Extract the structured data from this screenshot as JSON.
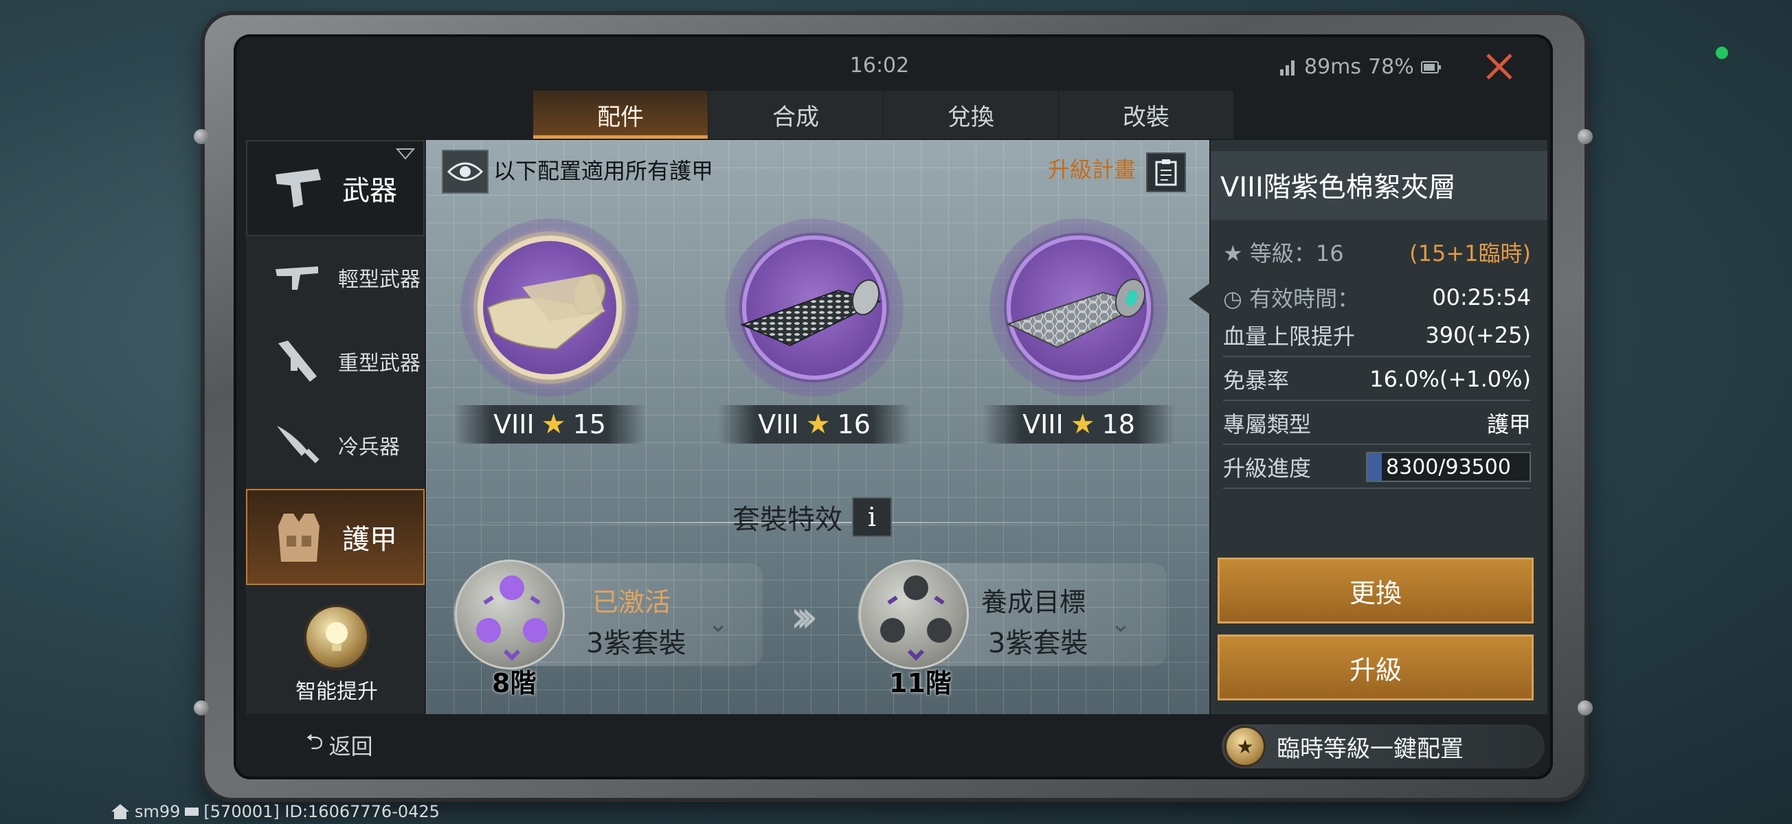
{
  "status": {
    "time": "16:02",
    "ping": "89ms",
    "battery": "78%"
  },
  "tabs": [
    {
      "label": "配件",
      "active": true
    },
    {
      "label": "合成",
      "active": false
    },
    {
      "label": "兌換",
      "active": false
    },
    {
      "label": "改裝",
      "active": false
    }
  ],
  "sidebar": {
    "weapons": "武器",
    "light": "輕型武器",
    "heavy": "重型武器",
    "melee": "冷兵器",
    "armor": "護甲",
    "smart": "智能提升"
  },
  "main": {
    "info_text": "以下配置適用所有護甲",
    "plan_label": "升級計畫",
    "items": [
      {
        "tier": "VIII",
        "stars": "15",
        "selected": true
      },
      {
        "tier": "VIII",
        "stars": "16",
        "selected": false
      },
      {
        "tier": "VIII",
        "stars": "18",
        "selected": false
      }
    ],
    "set_title": "套裝特效",
    "set_info_icon": "i",
    "set_current": {
      "state": "已激活",
      "name": "3紫套裝",
      "level": "8階"
    },
    "set_target": {
      "state": "養成目標",
      "name": "3紫套裝",
      "level": "11階"
    }
  },
  "detail": {
    "title": "VIII階紫色棉絮夾層",
    "level_key": "等級：16",
    "level_val": "(15+1臨時)",
    "time_key": "有效時間：",
    "time_val": "00:25:54",
    "hp_key": "血量上限提升",
    "hp_val": "390(+25)",
    "crit_key": "免暴率",
    "crit_val": "16.0%(+1.0%)",
    "type_key": "專屬類型",
    "type_val": "護甲",
    "progress_key": "升級進度",
    "progress_text": "8300/93500",
    "progress_fraction": 0.089,
    "replace_btn": "更換",
    "upgrade_btn": "升級"
  },
  "bottom": {
    "back": "返回",
    "quick": "臨時等級一鍵配置"
  },
  "footer": {
    "user": "sm99",
    "id_text": "[570001] ID:16067776-0425"
  },
  "colors": {
    "accent": "#c48a35",
    "purple": "#7a52ad",
    "status_ok": "#22c55e"
  }
}
